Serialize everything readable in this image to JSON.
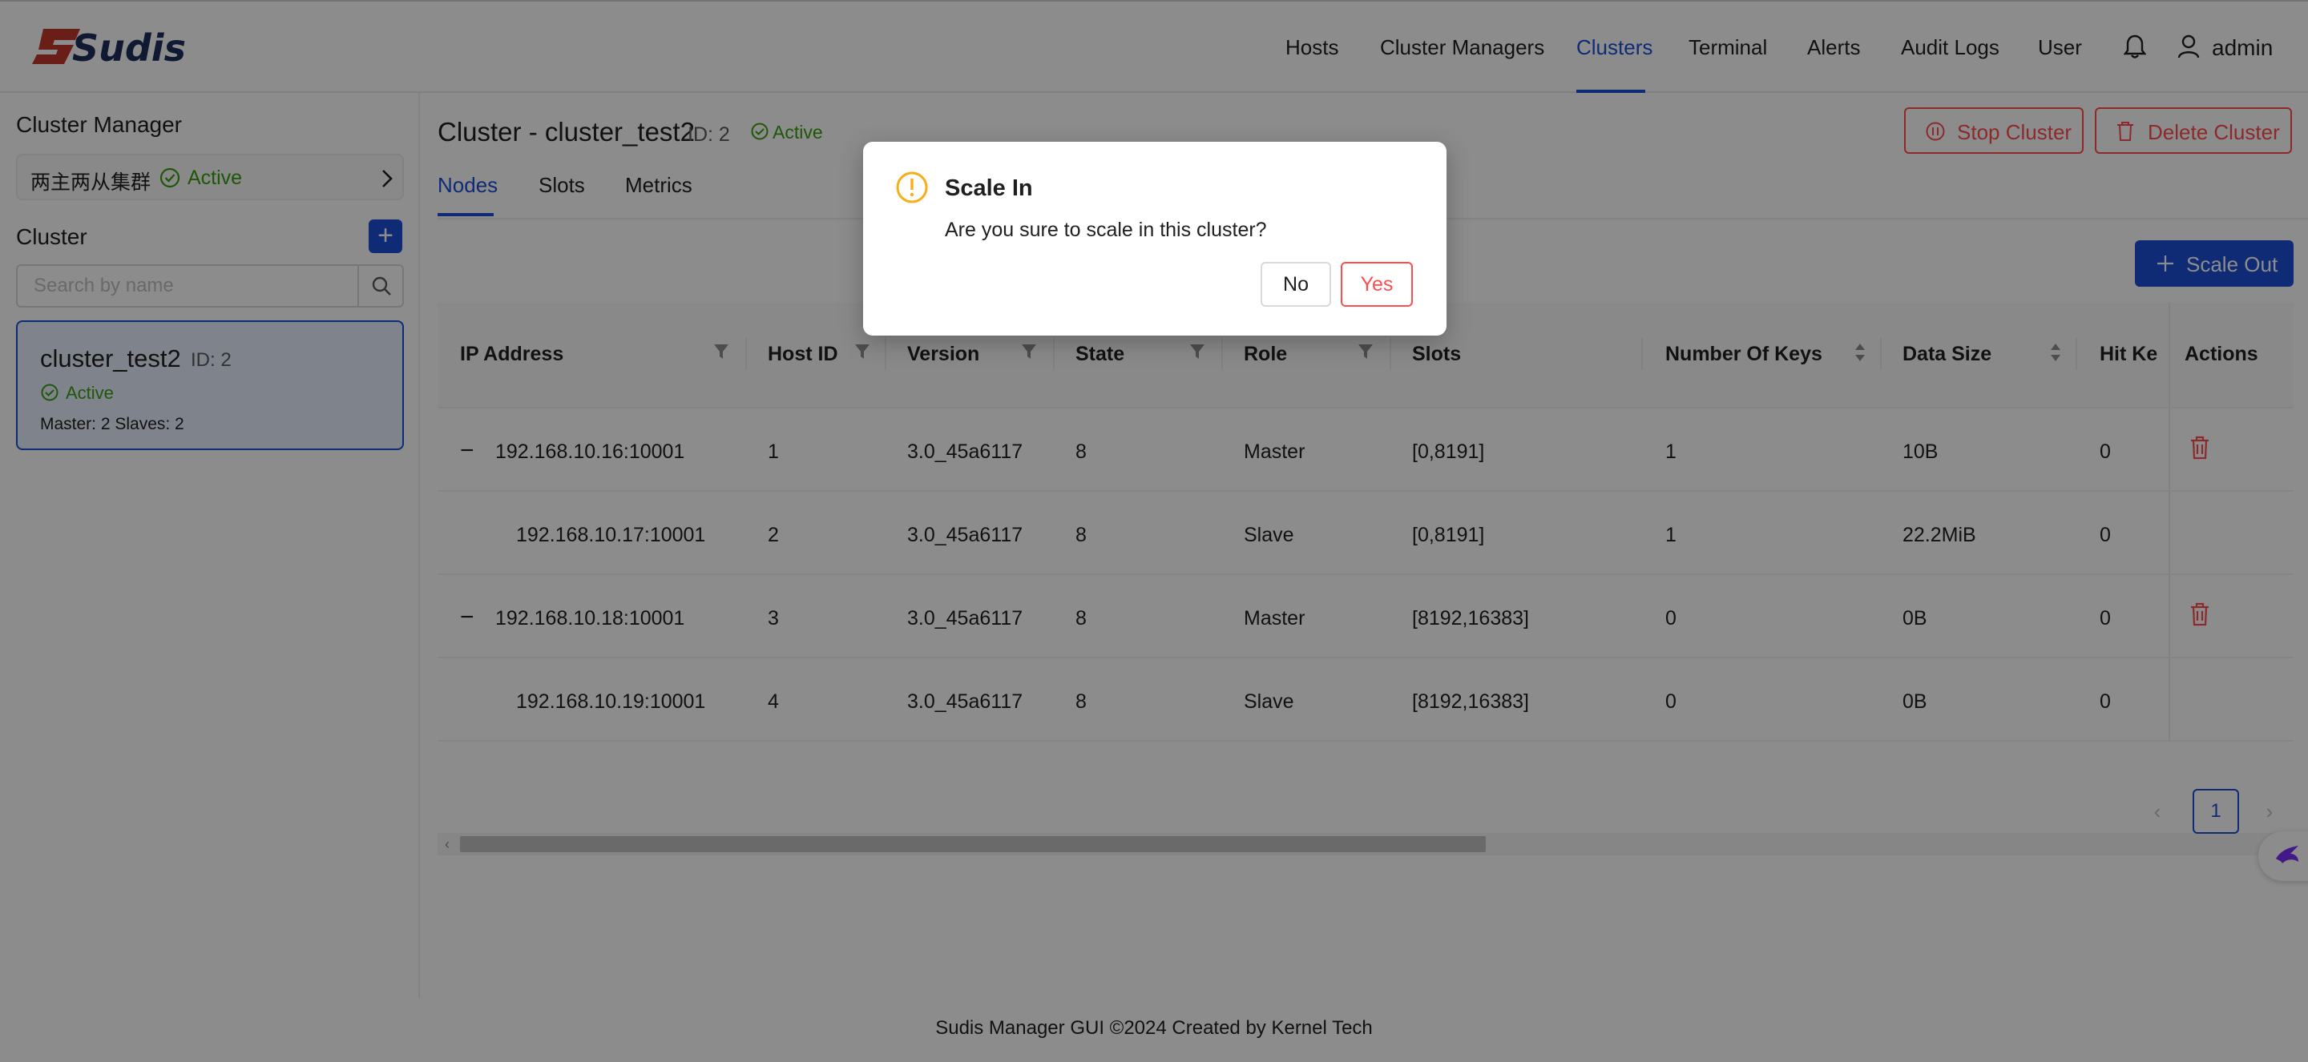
{
  "brand": {
    "logo_text": "Sudis"
  },
  "nav": {
    "items": [
      "Hosts",
      "Cluster Managers",
      "Clusters",
      "Terminal",
      "Alerts",
      "Audit Logs",
      "User"
    ],
    "active": "Clusters",
    "username": "admin"
  },
  "sidebar": {
    "cluster_manager_title": "Cluster Manager",
    "cluster_manager_name": "两主两从集群",
    "cluster_manager_status": "Active",
    "cluster_title": "Cluster",
    "add_label": "+",
    "search_placeholder": "Search by name",
    "selected_cluster": {
      "name": "cluster_test2",
      "id_label": "ID: 2",
      "status": "Active",
      "meta": "Master: 2   Slaves: 2"
    }
  },
  "main": {
    "title": "Cluster - cluster_test2",
    "id_label": "ID: 2",
    "status": "Active",
    "stop_label": "Stop Cluster",
    "delete_label": "Delete Cluster",
    "tabs": [
      "Nodes",
      "Slots",
      "Metrics"
    ],
    "active_tab": "Nodes",
    "scale_out_label": "Scale Out",
    "columns": [
      "IP Address",
      "Host ID",
      "Version",
      "State",
      "Role",
      "Slots",
      "Number Of Keys",
      "Data Size",
      "Hit Ke",
      "Actions"
    ],
    "rows": [
      {
        "ip": "192.168.10.16:10001",
        "host_id": "1",
        "version": "3.0_45a6117",
        "state": "8",
        "role": "Master",
        "slots": "[0,8191]",
        "keys": "1",
        "size": "10B",
        "hit": "0",
        "expandable": true
      },
      {
        "ip": "192.168.10.17:10001",
        "host_id": "2",
        "version": "3.0_45a6117",
        "state": "8",
        "role": "Slave",
        "slots": "[0,8191]",
        "keys": "1",
        "size": "22.2MiB",
        "hit": "0",
        "expandable": false
      },
      {
        "ip": "192.168.10.18:10001",
        "host_id": "3",
        "version": "3.0_45a6117",
        "state": "8",
        "role": "Master",
        "slots": "[8192,16383]",
        "keys": "0",
        "size": "0B",
        "hit": "0",
        "expandable": true
      },
      {
        "ip": "192.168.10.19:10001",
        "host_id": "4",
        "version": "3.0_45a6117",
        "state": "8",
        "role": "Slave",
        "slots": "[8192,16383]",
        "keys": "0",
        "size": "0B",
        "hit": "0",
        "expandable": false
      }
    ],
    "collapse_glyph": "−",
    "pagination": {
      "current_page": "1"
    }
  },
  "footer": {
    "text": "Sudis Manager GUI ©2024 Created by Kernel Tech"
  },
  "modal": {
    "title": "Scale In",
    "body": "Are you sure to scale in this cluster?",
    "no_label": "No",
    "yes_label": "Yes"
  },
  "colors": {
    "primary": "#1c4fd8",
    "danger": "#ff4d4f",
    "success": "#389e0d",
    "warning": "#faad14",
    "float_button_accent": "#7b2ff7"
  },
  "icons": [
    "bell-icon",
    "user-icon",
    "check-circle-icon",
    "chevron-right-icon",
    "search-icon",
    "pause-circle-icon",
    "trash-icon",
    "plus-icon",
    "filter-icon",
    "sort-icon",
    "exclamation-circle-icon"
  ]
}
